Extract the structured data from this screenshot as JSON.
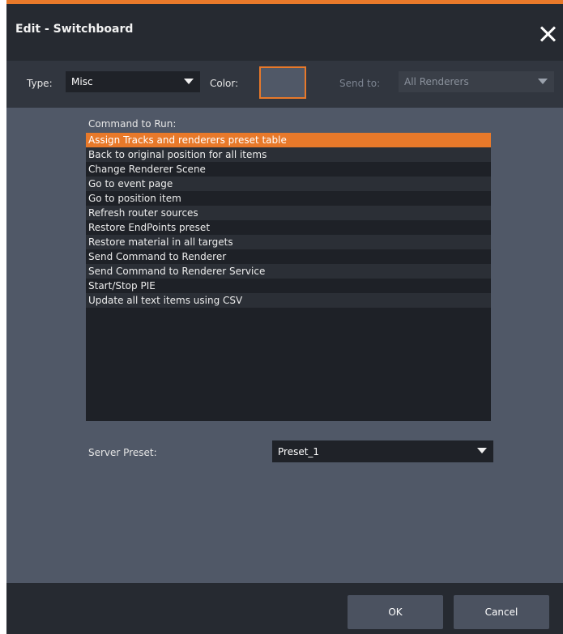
{
  "title": "Edit - Switchboard",
  "type": {
    "label": "Type:",
    "value": "Misc"
  },
  "color": {
    "label": "Color:"
  },
  "send_to": {
    "label": "Send to:",
    "value": "All Renderers"
  },
  "command": {
    "label": "Command to Run:",
    "items": [
      "Assign Tracks and renderers preset table",
      "Back to original position for all items",
      "Change Renderer Scene",
      "Go to event page",
      "Go to position item",
      "Refresh router sources",
      "Restore EndPoints preset",
      "Restore material in all targets",
      "Send Command to Renderer",
      "Send Command to Renderer Service",
      "Start/Stop PIE",
      "Update all text items using CSV"
    ],
    "selected_index": 0
  },
  "server_preset": {
    "label": "Server Preset:",
    "value": "Preset_1"
  },
  "buttons": {
    "ok": "OK",
    "cancel": "Cancel"
  },
  "colors": {
    "accent": "#e8792a",
    "titlebar": "#262a31",
    "panel": "#505867",
    "list": "#1e2127"
  }
}
